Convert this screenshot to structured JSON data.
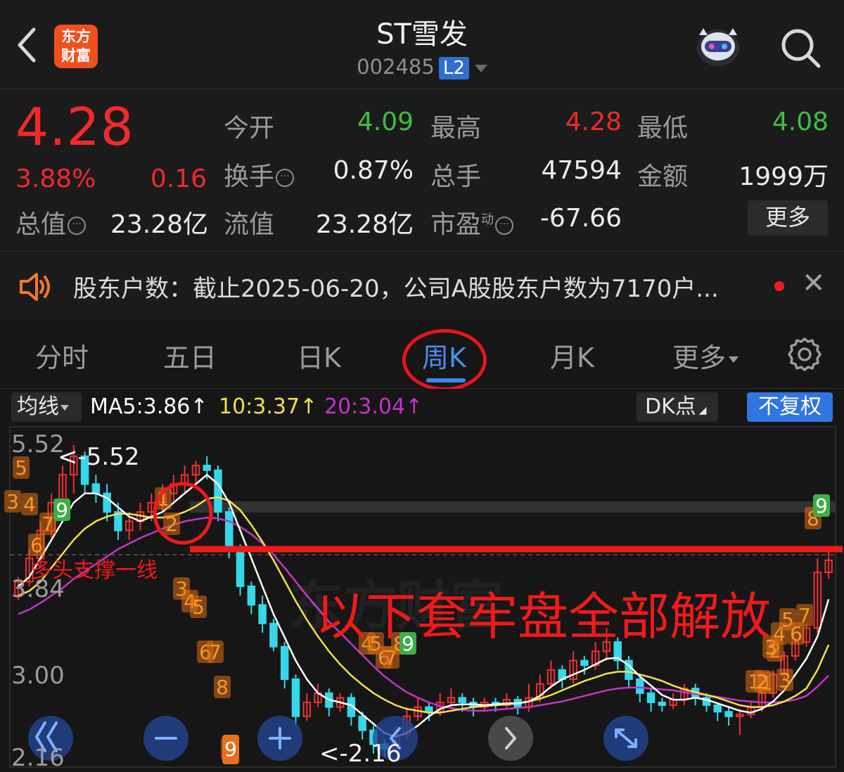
{
  "header": {
    "back_icon": "chevron-left-icon",
    "logo_line1": "东方",
    "logo_line2": "财富",
    "title": "ST雪发",
    "code": "002485",
    "level": "L2",
    "robot_icon": "robot-avatar-icon",
    "search_icon": "search-icon"
  },
  "quote": {
    "price": "4.28",
    "change_pct": "3.88%",
    "change": "0.16",
    "open_label": "今开",
    "open": "4.09",
    "high_label": "最高",
    "high": "4.28",
    "low_label": "最低",
    "low": "4.08",
    "turnover_label": "换手",
    "turnover": "0.87%",
    "volume_label": "总手",
    "volume": "47594",
    "amount_label": "金额",
    "amount": "1999万",
    "mktcap_label": "总值",
    "mktcap": "23.28亿",
    "float_label": "流值",
    "float": "23.28亿",
    "pe_label": "市盈",
    "pe_sup": "动",
    "pe": "-67.66",
    "more_label": "更多"
  },
  "notice": {
    "text": "股东户数：截止2025-06-20，公司A股股东户数为7170户...",
    "close": "✕"
  },
  "tabs": {
    "items": [
      "分时",
      "五日",
      "日K",
      "周K",
      "月K",
      "更多"
    ],
    "active": "周K"
  },
  "ma_bar": {
    "select_label": "均线",
    "ma5": "MA5:3.86",
    "ma10": "10:3.37",
    "ma20": "20:3.04",
    "arrow": "↑",
    "dk_label": "DK点",
    "adjust_label": "不复权",
    "colors": {
      "ma5": "#ffffff",
      "ma10": "#f2e04a",
      "ma20": "#c435c8"
    }
  },
  "chart_data": {
    "type": "candlestick",
    "period": "weekly",
    "ylim": [
      2.16,
      5.52
    ],
    "y_ticks": [
      "5.52",
      "3.84",
      "3.00",
      "2.16"
    ],
    "high_label": "<-5.52",
    "low_label": "<-2.16",
    "ohlc": [
      [
        3.9,
        4.05,
        3.85,
        4.1
      ],
      [
        4.05,
        4.3,
        4.0,
        4.4
      ],
      [
        4.3,
        4.6,
        4.2,
        4.7
      ],
      [
        4.6,
        4.9,
        4.5,
        5.0
      ],
      [
        4.9,
        5.2,
        4.7,
        5.3
      ],
      [
        5.2,
        5.4,
        5.0,
        5.52
      ],
      [
        5.4,
        5.1,
        5.0,
        5.45
      ],
      [
        5.1,
        5.0,
        4.9,
        5.2
      ],
      [
        5.0,
        4.8,
        4.7,
        5.1
      ],
      [
        4.8,
        4.6,
        4.5,
        4.9
      ],
      [
        4.6,
        4.7,
        4.5,
        4.8
      ],
      [
        4.7,
        4.8,
        4.6,
        4.9
      ],
      [
        4.8,
        4.9,
        4.7,
        5.0
      ],
      [
        4.9,
        5.0,
        4.8,
        5.1
      ],
      [
        5.0,
        5.1,
        4.9,
        5.2
      ],
      [
        5.1,
        5.2,
        5.0,
        5.3
      ],
      [
        5.2,
        5.3,
        5.1,
        5.35
      ],
      [
        5.3,
        5.25,
        5.15,
        5.4
      ],
      [
        5.25,
        4.8,
        4.7,
        5.3
      ],
      [
        4.8,
        4.4,
        4.3,
        4.85
      ],
      [
        4.4,
        4.0,
        3.9,
        4.45
      ],
      [
        4.0,
        3.8,
        3.7,
        4.05
      ],
      [
        3.8,
        3.6,
        3.5,
        3.9
      ],
      [
        3.6,
        3.35,
        3.3,
        3.65
      ],
      [
        3.35,
        3.0,
        2.9,
        3.4
      ],
      [
        3.0,
        2.6,
        2.5,
        3.05
      ],
      [
        2.6,
        2.75,
        2.55,
        2.85
      ],
      [
        2.75,
        2.85,
        2.7,
        2.95
      ],
      [
        2.85,
        2.7,
        2.6,
        2.9
      ],
      [
        2.7,
        2.8,
        2.65,
        2.85
      ],
      [
        2.8,
        2.6,
        2.5,
        2.85
      ],
      [
        2.6,
        2.45,
        2.35,
        2.65
      ],
      [
        2.45,
        2.3,
        2.2,
        2.5
      ],
      [
        2.3,
        2.25,
        2.16,
        2.35
      ],
      [
        2.25,
        2.4,
        2.2,
        2.5
      ],
      [
        2.4,
        2.6,
        2.35,
        2.7
      ],
      [
        2.6,
        2.7,
        2.55,
        2.8
      ],
      [
        2.7,
        2.65,
        2.55,
        2.75
      ],
      [
        2.65,
        2.75,
        2.6,
        2.85
      ],
      [
        2.75,
        2.8,
        2.7,
        2.9
      ],
      [
        2.8,
        2.75,
        2.65,
        2.85
      ],
      [
        2.75,
        2.7,
        2.6,
        2.8
      ],
      [
        2.7,
        2.75,
        2.65,
        2.8
      ],
      [
        2.75,
        2.72,
        2.65,
        2.8
      ],
      [
        2.72,
        2.78,
        2.68,
        2.85
      ],
      [
        2.78,
        2.7,
        2.62,
        2.82
      ],
      [
        2.7,
        2.8,
        2.65,
        2.95
      ],
      [
        2.8,
        2.95,
        2.75,
        3.05
      ],
      [
        2.95,
        3.1,
        2.9,
        3.2
      ],
      [
        3.1,
        3.0,
        2.9,
        3.15
      ],
      [
        3.0,
        3.2,
        2.95,
        3.3
      ],
      [
        3.2,
        3.15,
        3.05,
        3.25
      ],
      [
        3.15,
        3.3,
        3.1,
        3.4
      ],
      [
        3.3,
        3.4,
        3.2,
        3.55
      ],
      [
        3.4,
        3.2,
        3.1,
        3.45
      ],
      [
        3.2,
        3.0,
        2.9,
        3.25
      ],
      [
        3.0,
        2.85,
        2.75,
        3.05
      ],
      [
        2.85,
        2.75,
        2.65,
        2.9
      ],
      [
        2.75,
        2.72,
        2.65,
        2.8
      ],
      [
        2.72,
        2.78,
        2.68,
        2.85
      ],
      [
        2.78,
        2.9,
        2.72,
        2.95
      ],
      [
        2.9,
        2.8,
        2.72,
        2.95
      ],
      [
        2.8,
        2.72,
        2.65,
        2.85
      ],
      [
        2.72,
        2.65,
        2.55,
        2.75
      ],
      [
        2.65,
        2.6,
        2.5,
        2.7
      ],
      [
        2.6,
        2.62,
        2.4,
        2.68
      ],
      [
        2.62,
        2.7,
        2.58,
        2.75
      ],
      [
        2.7,
        2.85,
        2.65,
        2.9
      ],
      [
        2.85,
        3.05,
        2.8,
        3.1
      ],
      [
        3.05,
        3.25,
        3.0,
        3.3
      ],
      [
        3.25,
        3.4,
        3.2,
        3.45
      ],
      [
        3.4,
        3.55,
        3.35,
        3.6
      ],
      [
        3.55,
        4.15,
        3.5,
        4.3
      ],
      [
        4.15,
        4.28,
        4.08,
        4.4
      ]
    ],
    "ma5": [
      4.0,
      4.1,
      4.3,
      4.5,
      4.7,
      4.9,
      5.0,
      5.0,
      4.95,
      4.85,
      4.75,
      4.7,
      4.75,
      4.8,
      4.9,
      5.0,
      5.1,
      5.2,
      5.1,
      4.9,
      4.6,
      4.3,
      4.0,
      3.7,
      3.45,
      3.2,
      3.0,
      2.85,
      2.78,
      2.75,
      2.72,
      2.62,
      2.52,
      2.42,
      2.38,
      2.42,
      2.5,
      2.6,
      2.68,
      2.72,
      2.73,
      2.73,
      2.72,
      2.73,
      2.74,
      2.74,
      2.76,
      2.82,
      2.92,
      3.0,
      3.05,
      3.1,
      3.16,
      3.22,
      3.23,
      3.15,
      3.03,
      2.93,
      2.83,
      2.78,
      2.78,
      2.8,
      2.78,
      2.74,
      2.7,
      2.66,
      2.64,
      2.68,
      2.76,
      2.88,
      3.05,
      3.22,
      3.46,
      3.86
    ],
    "ma10": [
      3.9,
      3.95,
      4.05,
      4.2,
      4.35,
      4.5,
      4.62,
      4.7,
      4.75,
      4.78,
      4.78,
      4.76,
      4.74,
      4.74,
      4.76,
      4.8,
      4.86,
      4.94,
      4.96,
      4.92,
      4.82,
      4.66,
      4.48,
      4.28,
      4.06,
      3.84,
      3.64,
      3.46,
      3.3,
      3.16,
      3.04,
      2.94,
      2.85,
      2.78,
      2.72,
      2.68,
      2.66,
      2.64,
      2.64,
      2.66,
      2.68,
      2.7,
      2.71,
      2.72,
      2.73,
      2.74,
      2.76,
      2.79,
      2.83,
      2.88,
      2.93,
      2.98,
      3.02,
      3.06,
      3.08,
      3.08,
      3.05,
      3.02,
      2.98,
      2.93,
      2.89,
      2.86,
      2.83,
      2.8,
      2.76,
      2.72,
      2.7,
      2.7,
      2.72,
      2.76,
      2.82,
      2.9,
      3.1,
      3.37
    ],
    "ma20": [
      3.7,
      3.75,
      3.82,
      3.9,
      3.98,
      4.08,
      4.16,
      4.24,
      4.32,
      4.4,
      4.46,
      4.52,
      4.57,
      4.62,
      4.66,
      4.7,
      4.72,
      4.74,
      4.73,
      4.7,
      4.64,
      4.56,
      4.46,
      4.34,
      4.2,
      4.05,
      3.9,
      3.76,
      3.62,
      3.5,
      3.38,
      3.26,
      3.14,
      3.03,
      2.94,
      2.86,
      2.8,
      2.75,
      2.71,
      2.69,
      2.67,
      2.66,
      2.66,
      2.67,
      2.68,
      2.69,
      2.7,
      2.72,
      2.74,
      2.76,
      2.79,
      2.82,
      2.85,
      2.88,
      2.9,
      2.91,
      2.91,
      2.9,
      2.89,
      2.88,
      2.86,
      2.84,
      2.83,
      2.81,
      2.79,
      2.77,
      2.76,
      2.75,
      2.75,
      2.76,
      2.78,
      2.82,
      2.92,
      3.04
    ]
  },
  "annotations": {
    "support_text": "多头支撑一线",
    "headline": "以下套牢盘全部解放",
    "watermark": "东方财富",
    "td_counts": [
      {
        "t": "5",
        "c": "o"
      },
      {
        "t": "3",
        "c": "o"
      },
      {
        "t": "4",
        "c": "o"
      },
      {
        "t": "6",
        "c": "o"
      },
      {
        "t": "7",
        "c": "o"
      },
      {
        "t": "9",
        "c": "g"
      },
      {
        "t": "1",
        "c": "o"
      },
      {
        "t": "2",
        "c": "o"
      },
      {
        "t": "3",
        "c": "o"
      },
      {
        "t": "4",
        "c": "o"
      },
      {
        "t": "5",
        "c": "o"
      },
      {
        "t": "6",
        "c": "o"
      },
      {
        "t": "7",
        "c": "o"
      },
      {
        "t": "8",
        "c": "o"
      },
      {
        "t": "9",
        "c": "o"
      },
      {
        "t": "4",
        "c": "o"
      },
      {
        "t": "5",
        "c": "o"
      },
      {
        "t": "6",
        "c": "o"
      },
      {
        "t": "7",
        "c": "o"
      },
      {
        "t": "8",
        "c": "o"
      },
      {
        "t": "9",
        "c": "g"
      },
      {
        "t": "1",
        "c": "o"
      },
      {
        "t": "2",
        "c": "o"
      },
      {
        "t": "3",
        "c": "o"
      },
      {
        "t": "1",
        "c": "o"
      },
      {
        "t": "2",
        "c": "o"
      },
      {
        "t": "3",
        "c": "o"
      },
      {
        "t": "4",
        "c": "o"
      },
      {
        "t": "5",
        "c": "o"
      },
      {
        "t": "6",
        "c": "o"
      },
      {
        "t": "7",
        "c": "o"
      },
      {
        "t": "8",
        "c": "o"
      },
      {
        "t": "9",
        "c": "g"
      }
    ]
  },
  "controls": {
    "icons": [
      "double-left-icon",
      "zoom-out-icon",
      "zoom-in-icon",
      "left-icon",
      "right-icon",
      "fullscreen-icon"
    ]
  }
}
